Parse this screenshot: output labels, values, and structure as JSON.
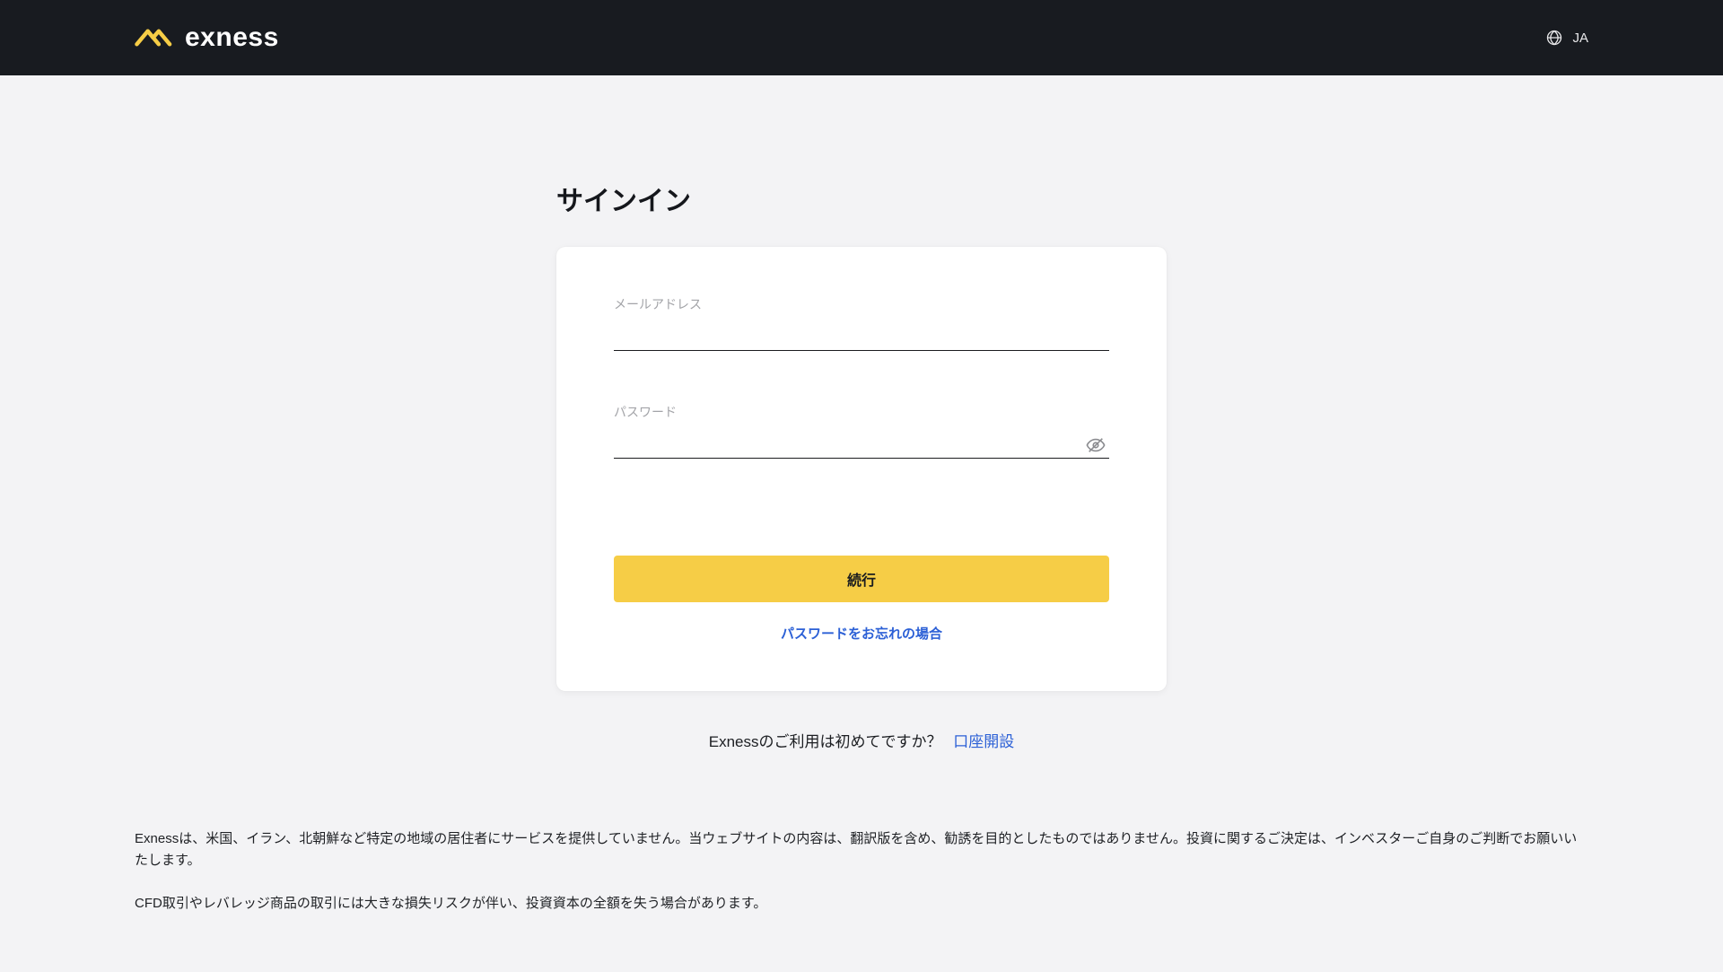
{
  "header": {
    "brand": "exness",
    "language_code": "JA"
  },
  "page": {
    "title": "サインイン"
  },
  "form": {
    "email_label": "メールアドレス",
    "password_label": "パスワード",
    "submit_label": "続行",
    "forgot_password": "パスワードをお忘れの場合"
  },
  "signup": {
    "prompt": "Exnessのご利用は初めてですか？",
    "link_text": "口座開設"
  },
  "disclaimer": {
    "p1": "Exnessは、米国、イラン、北朝鮮など特定の地域の居住者にサービスを提供していません。当ウェブサイトの内容は、翻訳版を含め、勧誘を目的としたものではありません。投資に関するご決定は、インベスターご自身のご判断でお願いいたします。",
    "p2": "CFD取引やレバレッジ商品の取引には大きな損失リスクが伴い、投資資本の全額を失う場合があります。"
  },
  "colors": {
    "accent": "#f6cd46",
    "link": "#2c60d6",
    "header_bg": "#181b20"
  }
}
